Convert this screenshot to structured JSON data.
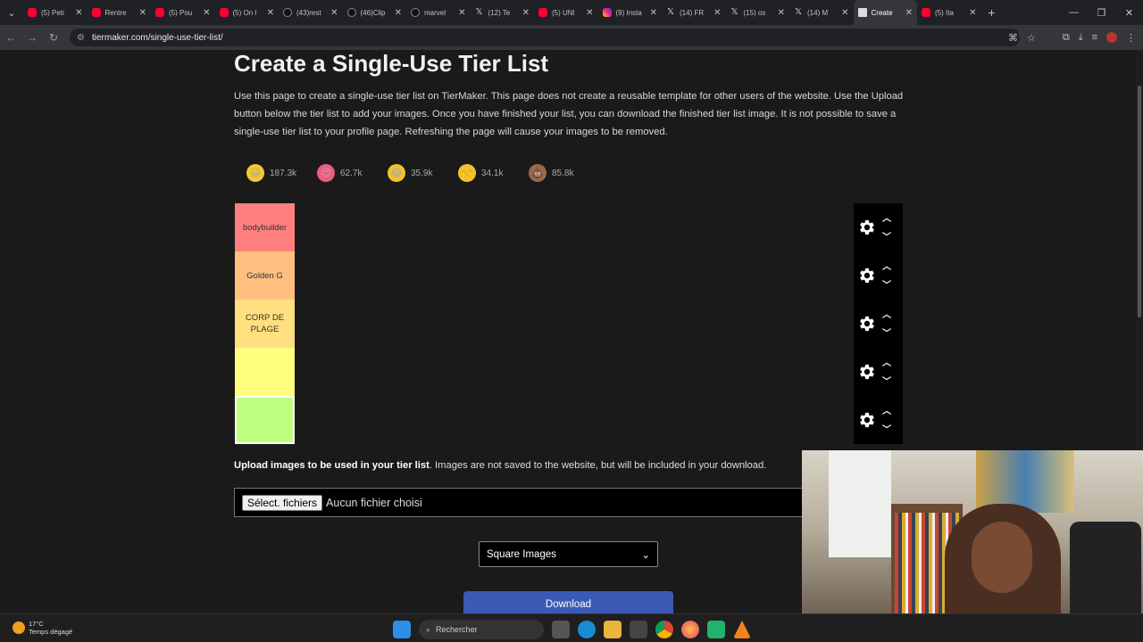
{
  "browser": {
    "tabs": [
      {
        "title": "(5) Peti",
        "icon": "youtube"
      },
      {
        "title": "Rentre",
        "icon": "youtube"
      },
      {
        "title": "(5) Pou",
        "icon": "youtube"
      },
      {
        "title": "(5) On l",
        "icon": "youtube"
      },
      {
        "title": "(43)rest",
        "icon": "tiktok"
      },
      {
        "title": "(46)Clip",
        "icon": "tiktok"
      },
      {
        "title": "marvel",
        "icon": "tiktok"
      },
      {
        "title": "(12) Te",
        "icon": "x"
      },
      {
        "title": "(5) UNI",
        "icon": "youtube"
      },
      {
        "title": "(9) Insta",
        "icon": "instagram"
      },
      {
        "title": "(14) FR",
        "icon": "x"
      },
      {
        "title": "(15) os",
        "icon": "x"
      },
      {
        "title": "(14) M",
        "icon": "x"
      },
      {
        "title": "Create",
        "icon": "tiermaker",
        "active": true
      },
      {
        "title": "(5) Ita",
        "icon": "youtube"
      }
    ],
    "url": "tiermaker.com/single-use-tier-list/"
  },
  "page": {
    "title": "Create a Single-Use Tier List",
    "description": "Use this page to create a single-use tier list on TierMaker. This page does not create a reusable template for other users of the website. Use the Upload button below the tier list to add your images. Once you have finished your list, you can download the finished tier list image. It is not possible to save a single-use tier list to your profile page. Refreshing the page will cause your images to be removed.",
    "reactions": [
      {
        "emoji": "😀",
        "count": "187.3k"
      },
      {
        "emoji": "😍",
        "count": "62.7k"
      },
      {
        "emoji": "😂",
        "count": "35.9k"
      },
      {
        "emoji": "🙌",
        "count": "34.1k"
      },
      {
        "emoji": "💩",
        "count": "85.8k"
      }
    ],
    "tiers": [
      {
        "label": "bodybuilder",
        "color": "#ff7f7f"
      },
      {
        "label": "Golden G",
        "color": "#ffbf7f"
      },
      {
        "label": "CORP DE PLAGE",
        "color": "#ffdf7f"
      },
      {
        "label": "",
        "color": "#ffff7f"
      },
      {
        "label": "",
        "color": "#bfff7f"
      }
    ],
    "upload_bold": "Upload images to be used in your tier list",
    "upload_rest": ". Images are not saved to the website, but will be included in your download.",
    "file_button": "Sélect. fichiers",
    "file_status": "Aucun fichier choisi",
    "image_shape": "Square Images",
    "download_label": "Download"
  },
  "taskbar": {
    "temperature": "17°C",
    "weather": "Temps dégagé",
    "search_placeholder": "Rechercher"
  }
}
